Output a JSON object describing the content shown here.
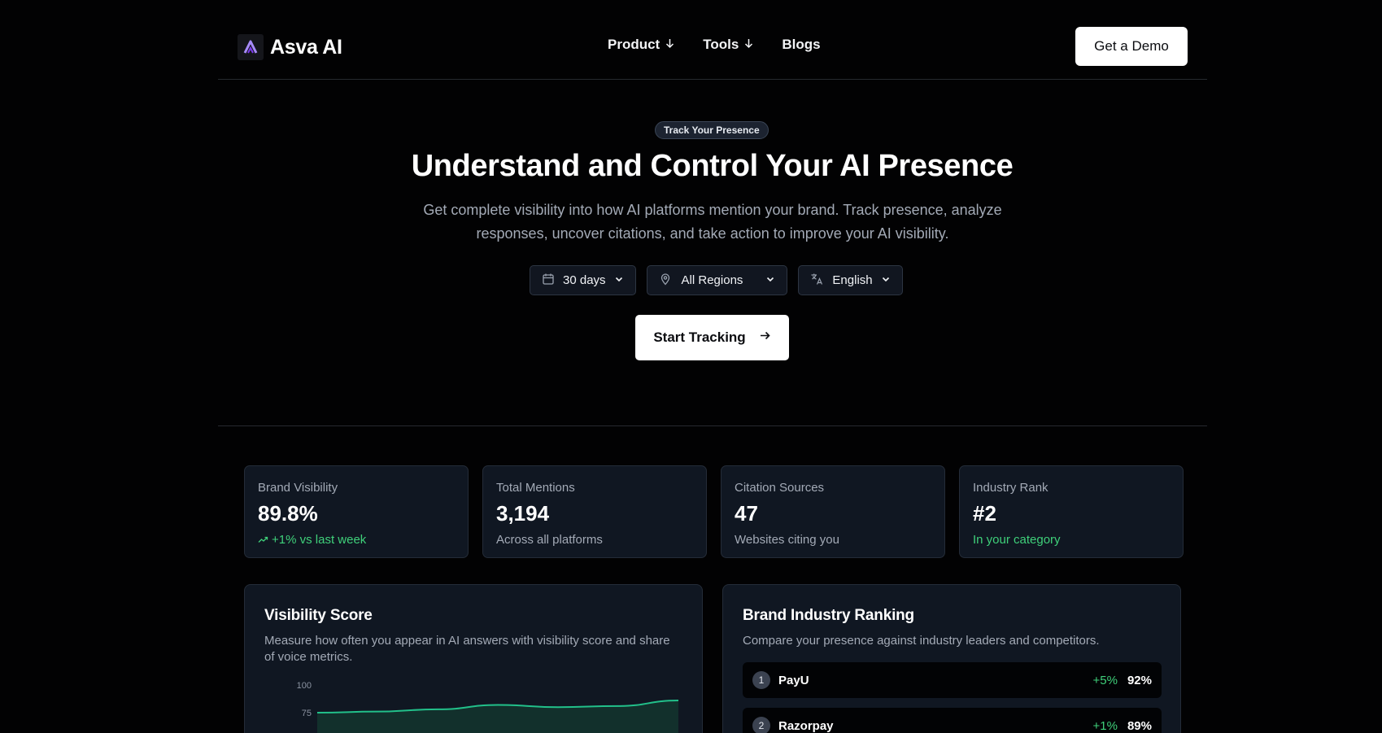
{
  "brand": {
    "name": "Asva AI",
    "accent": "#a78bfa"
  },
  "nav": {
    "items": [
      {
        "label": "Product",
        "has_dropdown": true
      },
      {
        "label": "Tools",
        "has_dropdown": true
      },
      {
        "label": "Blogs",
        "has_dropdown": false
      }
    ],
    "cta": "Get a Demo"
  },
  "hero": {
    "badge": "Track Your Presence",
    "title": "Understand and Control Your AI Presence",
    "subtitle": "Get complete visibility into how AI platforms mention your brand. Track presence, analyze responses, uncover citations, and take action to improve your AI visibility.",
    "filters": {
      "period": {
        "value": "30 days",
        "icon": "calendar-icon"
      },
      "region": {
        "value": "All Regions",
        "icon": "map-pin-icon"
      },
      "language": {
        "value": "English",
        "icon": "translate-icon"
      }
    },
    "cta": "Start Tracking"
  },
  "stats": [
    {
      "label": "Brand Visibility",
      "value": "89.8%",
      "note": "+1% vs last week",
      "note_color": "#3fd07a",
      "icon": "trending-up-icon"
    },
    {
      "label": "Total Mentions",
      "value": "3,194",
      "note": "Across all platforms"
    },
    {
      "label": "Citation Sources",
      "value": "47",
      "note": "Websites citing you"
    },
    {
      "label": "Industry Rank",
      "value": "#2",
      "note": "In your category",
      "note_color": "#3fd07a"
    }
  ],
  "visibility_panel": {
    "title": "Visibility Score",
    "description": "Measure how often you appear in AI answers with visibility score and share of voice metrics."
  },
  "ranking_panel": {
    "title": "Brand Industry Ranking",
    "description": "Compare your presence against industry leaders and competitors.",
    "rows": [
      {
        "rank": "1",
        "name": "PayU",
        "change": "+5%",
        "score": "92%"
      },
      {
        "rank": "2",
        "name": "Razorpay",
        "change": "+1%",
        "score": "89%"
      }
    ]
  },
  "chart_data": {
    "type": "area",
    "ylim": [
      0,
      100
    ],
    "y_ticks": [
      "100",
      "75"
    ],
    "line_color": "#22c08a",
    "series": [
      {
        "values": [
          75,
          76,
          78,
          82,
          80,
          81,
          86
        ]
      }
    ]
  }
}
